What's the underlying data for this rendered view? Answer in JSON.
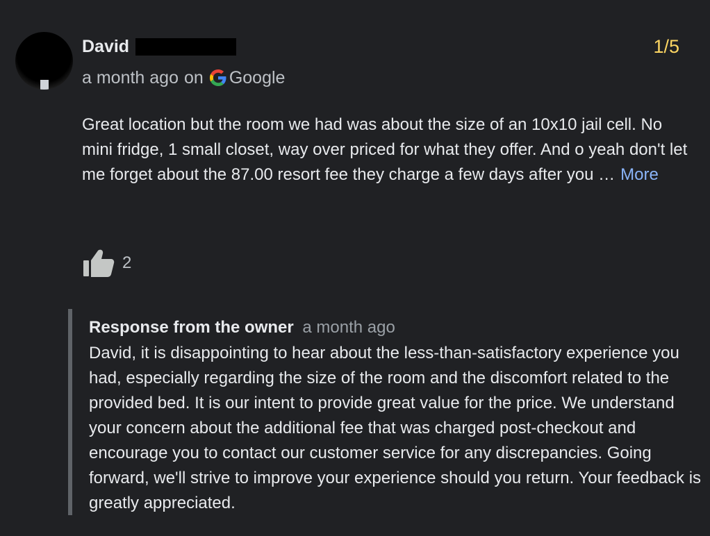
{
  "review": {
    "reviewer_name": "David",
    "rating": "1/5",
    "time_ago": "a month ago",
    "on": "on",
    "source": "Google",
    "text": "Great location but the room we had was about the size of an 10x10 jail cell. No mini fridge, 1 small closet, way over priced for what they offer. And o yeah don't let me forget about the 87.00 resort fee they charge a few days after you …",
    "more_label": "More",
    "likes": "2",
    "icons": {
      "avatar": "avatar-redacted",
      "source": "google-g-icon",
      "like": "thumbs-up-icon"
    }
  },
  "owner_response": {
    "label": "Response from the owner",
    "time_ago": "a month ago",
    "text": "David, it is disappointing to hear about the less-than-satisfactory experience you had, especially regarding the size of the room and the discomfort related to the provided bed. It is our intent to provide great value for the price. We understand your concern about the additional fee that was charged post-checkout and encourage you to contact our customer service for any discrepancies. Going forward, we'll strive to improve your experience should you return. Your feedback is greatly appreciated."
  },
  "colors": {
    "background": "#202124",
    "rating": "#fdd663",
    "link": "#8ab4f8",
    "muted": "#bdc1c6"
  }
}
